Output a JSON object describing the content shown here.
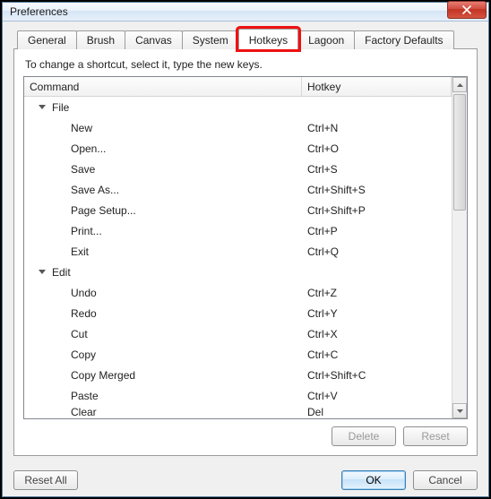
{
  "window": {
    "title": "Preferences"
  },
  "tabs": {
    "items": [
      {
        "label": "General"
      },
      {
        "label": "Brush"
      },
      {
        "label": "Canvas"
      },
      {
        "label": "System"
      },
      {
        "label": "Hotkeys"
      },
      {
        "label": "Lagoon"
      },
      {
        "label": "Factory Defaults"
      }
    ],
    "active_index": 4,
    "highlighted_index": 4
  },
  "hotkeys_panel": {
    "instruction": "To change a shortcut, select it, type the new keys.",
    "columns": {
      "command": "Command",
      "hotkey": "Hotkey"
    },
    "rows": [
      {
        "type": "group",
        "label": "File"
      },
      {
        "type": "item",
        "label": "New",
        "hotkey": "Ctrl+N"
      },
      {
        "type": "item",
        "label": "Open...",
        "hotkey": "Ctrl+O"
      },
      {
        "type": "item",
        "label": "Save",
        "hotkey": "Ctrl+S"
      },
      {
        "type": "item",
        "label": "Save As...",
        "hotkey": "Ctrl+Shift+S"
      },
      {
        "type": "item",
        "label": "Page Setup...",
        "hotkey": "Ctrl+Shift+P"
      },
      {
        "type": "item",
        "label": "Print...",
        "hotkey": "Ctrl+P"
      },
      {
        "type": "item",
        "label": "Exit",
        "hotkey": "Ctrl+Q"
      },
      {
        "type": "group",
        "label": "Edit"
      },
      {
        "type": "item",
        "label": "Undo",
        "hotkey": "Ctrl+Z"
      },
      {
        "type": "item",
        "label": "Redo",
        "hotkey": "Ctrl+Y"
      },
      {
        "type": "item",
        "label": "Cut",
        "hotkey": "Ctrl+X"
      },
      {
        "type": "item",
        "label": "Copy",
        "hotkey": "Ctrl+C"
      },
      {
        "type": "item",
        "label": "Copy Merged",
        "hotkey": "Ctrl+Shift+C"
      },
      {
        "type": "item",
        "label": "Paste",
        "hotkey": "Ctrl+V"
      },
      {
        "type": "item",
        "label": "Clear",
        "hotkey": "Del",
        "clipped": true
      }
    ],
    "buttons": {
      "delete": "Delete",
      "reset": "Reset"
    }
  },
  "dialog_buttons": {
    "reset_all": "Reset All",
    "ok": "OK",
    "cancel": "Cancel"
  }
}
